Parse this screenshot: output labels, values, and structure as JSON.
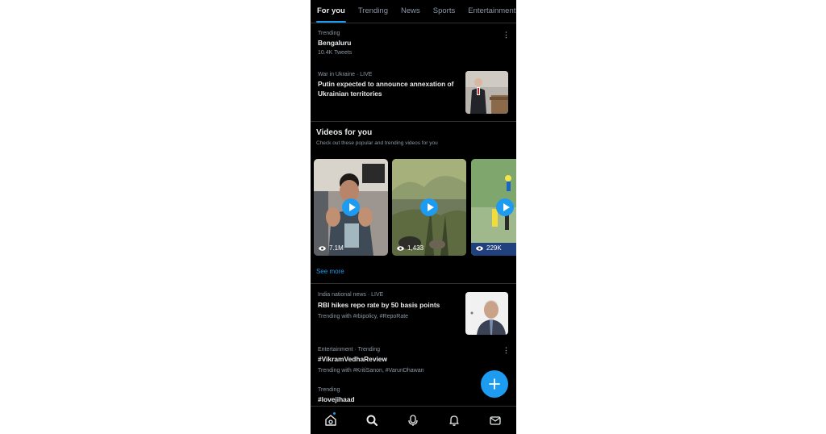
{
  "tabs": [
    {
      "label": "For you",
      "active": true
    },
    {
      "label": "Trending",
      "active": false
    },
    {
      "label": "News",
      "active": false
    },
    {
      "label": "Sports",
      "active": false
    },
    {
      "label": "Entertainment",
      "active": false
    }
  ],
  "trend_1": {
    "context": "Trending",
    "title": "Bengaluru",
    "count": "10.4K Tweets"
  },
  "news_1": {
    "context": "War in Ukraine · LIVE",
    "title": "Putin expected to announce annexation of Ukrainian territories"
  },
  "videos": {
    "title": "Videos for you",
    "subtitle": "Check out these popular and trending videos for you",
    "items": [
      {
        "views": "7.1M"
      },
      {
        "views": "1,433"
      },
      {
        "views": "229K"
      }
    ],
    "see_more": "See more"
  },
  "news_2": {
    "context": "India national news · LIVE",
    "title": "RBI hikes repo rate by 50 basis points",
    "trending_with": "Trending with #rbipolicy, #RepoRate"
  },
  "trend_2": {
    "context": "Entertainment · Trending",
    "title": "#VikramVedhaReview",
    "trending_with": "Trending with #KritiSanon, #VarunDhawan"
  },
  "trend_3": {
    "context": "Trending",
    "title": "#lovejihaad"
  },
  "bottom_nav": [
    "home-icon",
    "search-icon",
    "spaces-icon",
    "notifications-icon",
    "messages-icon"
  ],
  "colors": {
    "accent": "#1d9bf0",
    "background": "#000000",
    "text": "#e7e9ea",
    "muted": "#8b98a5",
    "divider": "#2f3336"
  }
}
